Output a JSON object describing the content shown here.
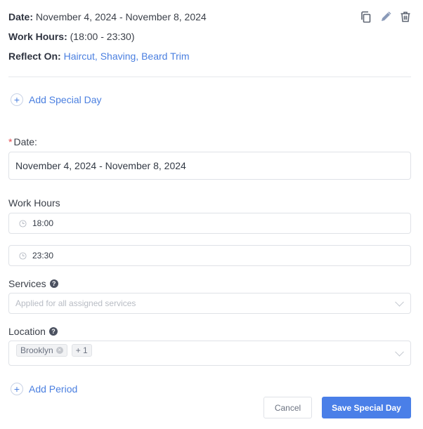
{
  "summary": {
    "date_label": "Date:",
    "date_value": "November 4, 2024 - November 8, 2024",
    "hours_label": "Work Hours:",
    "hours_value": "(18:00 - 23:30)",
    "reflect_label": "Reflect On:",
    "reflect_value": "Haircut, Shaving, Beard Trim",
    "actions": [
      "copy-icon",
      "edit-icon",
      "trash-icon"
    ]
  },
  "add_special_day": {
    "icon": "plus-circle-icon",
    "label": "Add Special Day"
  },
  "form": {
    "date": {
      "required_mark": "*",
      "label": "Date:",
      "value": "November 4, 2024 - November 8, 2024"
    },
    "work_hours": {
      "label": "Work Hours",
      "start": "18:00",
      "end": "23:30",
      "icon": "clock-icon"
    },
    "services": {
      "label": "Services",
      "help": "?",
      "placeholder": "Applied for all assigned services"
    },
    "location": {
      "label": "Location",
      "help": "?",
      "tags": [
        {
          "label": "Brooklyn",
          "remove": "×"
        }
      ],
      "more": "+ 1"
    }
  },
  "add_period": {
    "icon": "plus-circle-icon",
    "label": "Add Period"
  },
  "footer": {
    "cancel_label": "Cancel",
    "save_label": "Save Special Day"
  },
  "colors": {
    "accent": "#4a7fe8",
    "link": "#4a7fe0",
    "required": "#e5484d"
  }
}
